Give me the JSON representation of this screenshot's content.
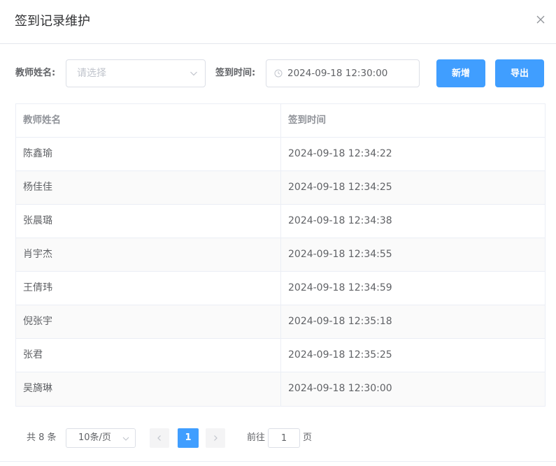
{
  "dialog": {
    "title": "签到记录维护"
  },
  "filters": {
    "teacher_label": "教师姓名:",
    "teacher_placeholder": "请选择",
    "time_label": "签到时间:",
    "time_value": "2024-09-18 12:30:00",
    "add_label": "新增",
    "export_label": "导出"
  },
  "table": {
    "headers": [
      "教师姓名",
      "签到时间"
    ],
    "rows": [
      {
        "name": "陈鑫瑜",
        "time": "2024-09-18 12:34:22"
      },
      {
        "name": "杨佳佳",
        "time": "2024-09-18 12:34:25"
      },
      {
        "name": "张晨璐",
        "time": "2024-09-18 12:34:38"
      },
      {
        "name": "肖宇杰",
        "time": "2024-09-18 12:34:55"
      },
      {
        "name": "王倩玮",
        "time": "2024-09-18 12:34:59"
      },
      {
        "name": "倪张宇",
        "time": "2024-09-18 12:35:18"
      },
      {
        "name": "张君",
        "time": "2024-09-18 12:35:25"
      },
      {
        "name": "吴旖琳",
        "time": "2024-09-18 12:30:00"
      }
    ]
  },
  "pagination": {
    "total_text": "共 8 条",
    "page_size": "10条/页",
    "current_page": "1",
    "goto_label": "前往",
    "goto_value": "1",
    "page_unit": "页"
  },
  "colors": {
    "primary": "#409eff",
    "border": "#dcdfe6",
    "text": "#606266",
    "header_text": "#909399",
    "placeholder": "#c0c4cc"
  }
}
